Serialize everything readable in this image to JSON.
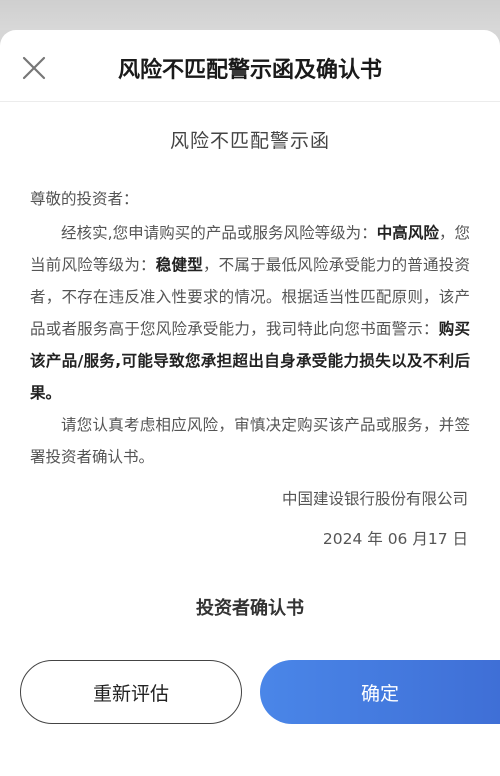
{
  "header": {
    "title": "风险不匹配警示函及确认书",
    "close_icon": "close-icon"
  },
  "letter": {
    "title": "风险不匹配警示函",
    "greeting": "尊敬的投资者：",
    "para1_a": "经核实,您申请购买的产品或服务风险等级为：",
    "para1_product_risk": "中高风险",
    "para1_b": "，您当前风险等级为：",
    "para1_user_risk": "稳健型",
    "para1_c": "，不属于最低风险承受能力的普通投资者，不存在违反准入性要求的情况。根据适当性匹配原则，该产品或者服务高于您风险承受能力，我司特此向您书面警示：",
    "para1_warning": "购买该产品/服务,可能导致您承担超出自身承受能力损失以及不利后果。",
    "para2": "请您认真考虑相应风险，审慎决定购买该产品或服务，并签署投资者确认书。",
    "company": "中国建设银行股份有限公司",
    "date": "2024 年 06 月17 日"
  },
  "confirmation": {
    "title": "投资者确认书"
  },
  "buttons": {
    "reassess": "重新评估",
    "confirm": "确定"
  },
  "colors": {
    "confirm_button": "#4a86e8",
    "background": "#ffffff"
  }
}
